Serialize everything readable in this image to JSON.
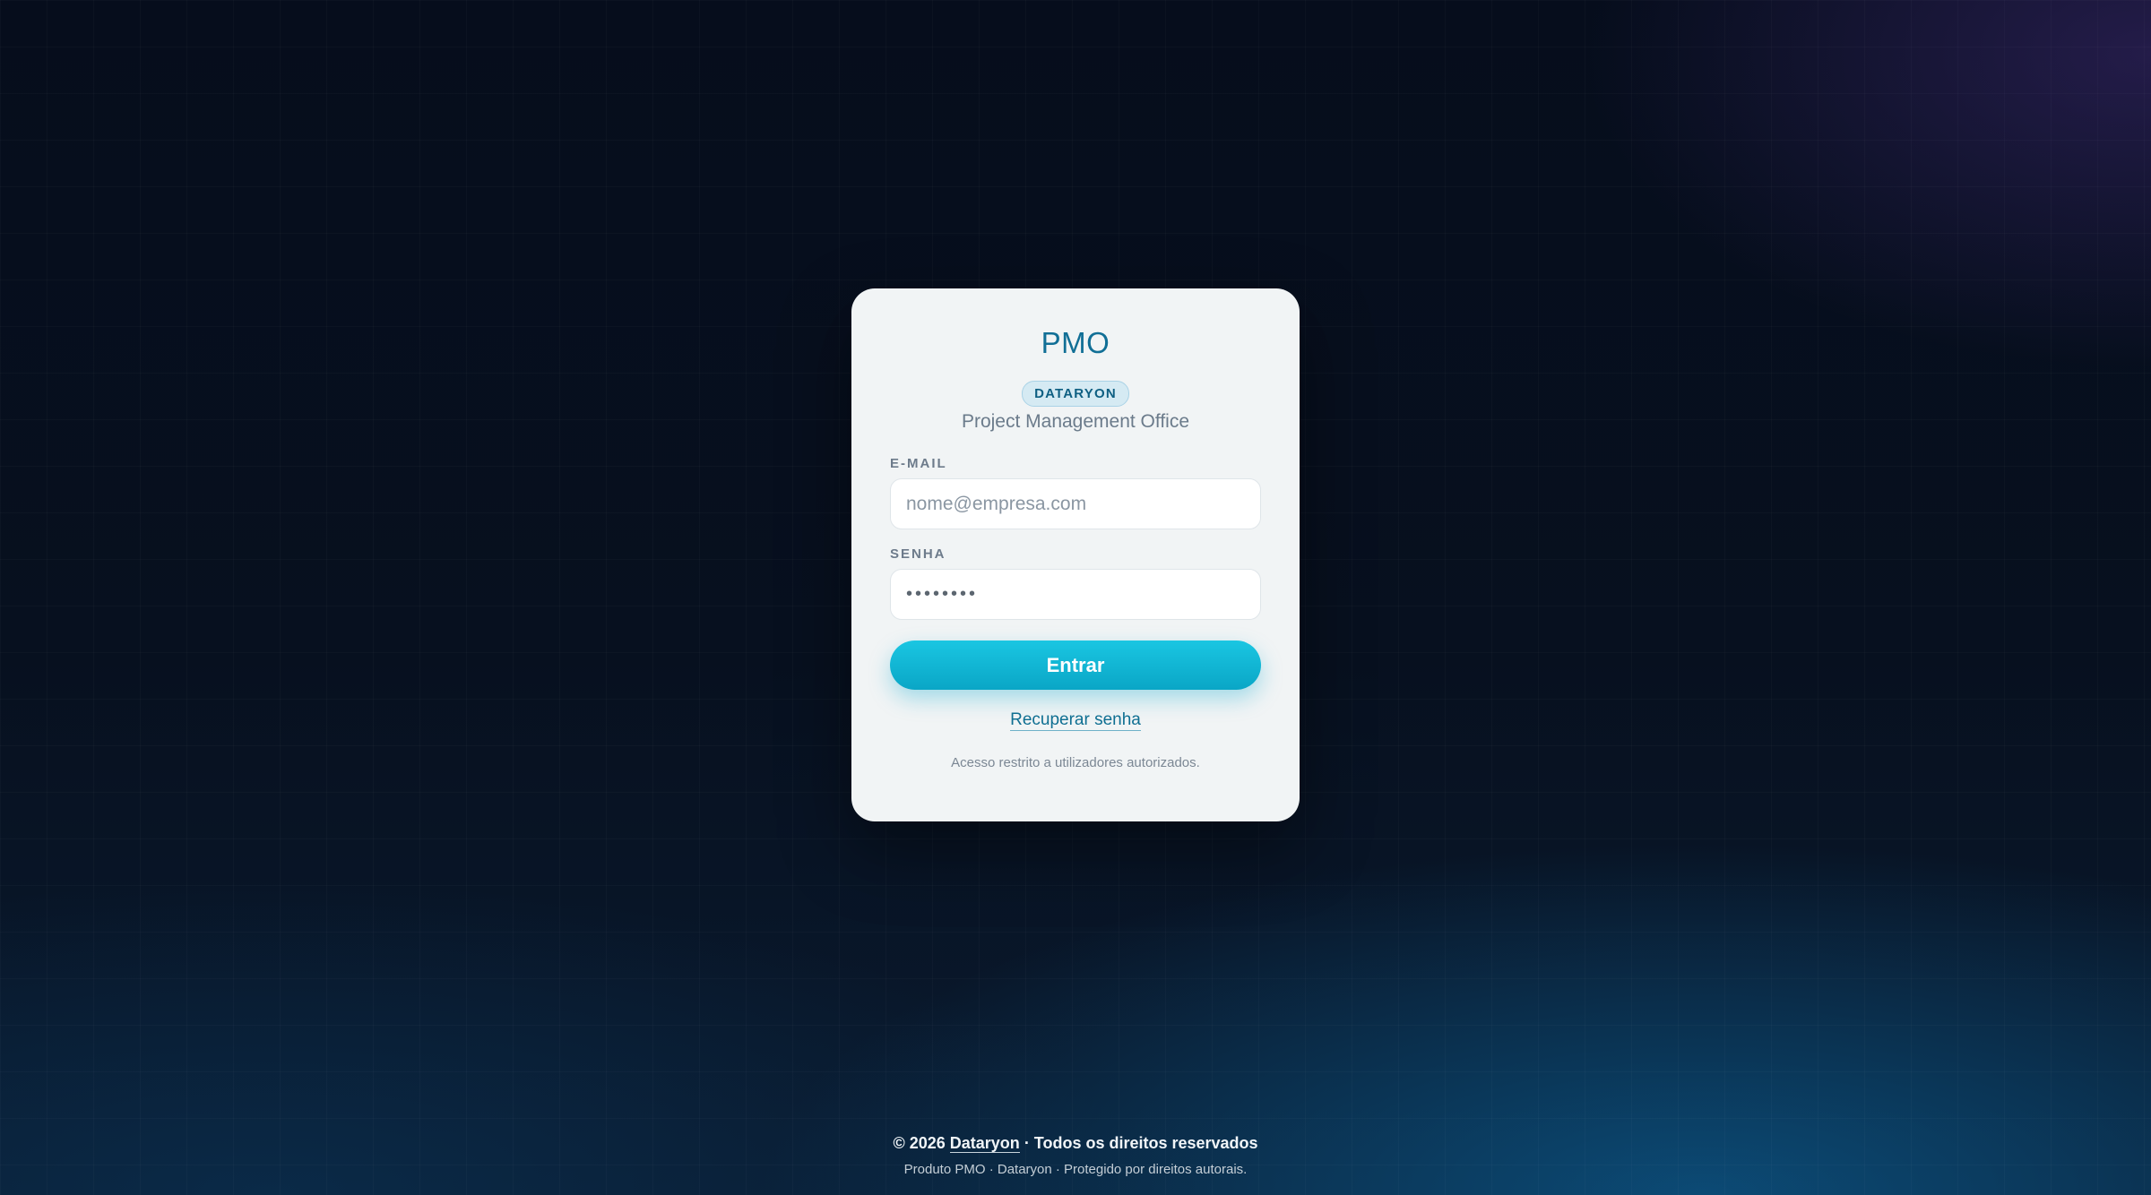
{
  "login": {
    "title": "PMO",
    "badge": "DATARYON",
    "subtitle": "Project Management Office",
    "email_label": "E-MAIL",
    "email_placeholder": "nome@empresa.com",
    "email_value": "",
    "password_label": "SENHA",
    "password_value": "••••••••",
    "submit_label": "Entrar",
    "recover_link": "Recuperar senha",
    "restricted_note": "Acesso restrito a utilizadores autorizados."
  },
  "footer": {
    "copyright_prefix": "© 2026",
    "company": "Dataryon",
    "rights": "· Todos os direitos reservados",
    "product_line": "Produto PMO · Dataryon · Protegido por direitos autorais."
  },
  "colors": {
    "accent": "#0aa6c6",
    "title": "#116f96",
    "background": "#07101f",
    "card": "#f1f4f5"
  }
}
